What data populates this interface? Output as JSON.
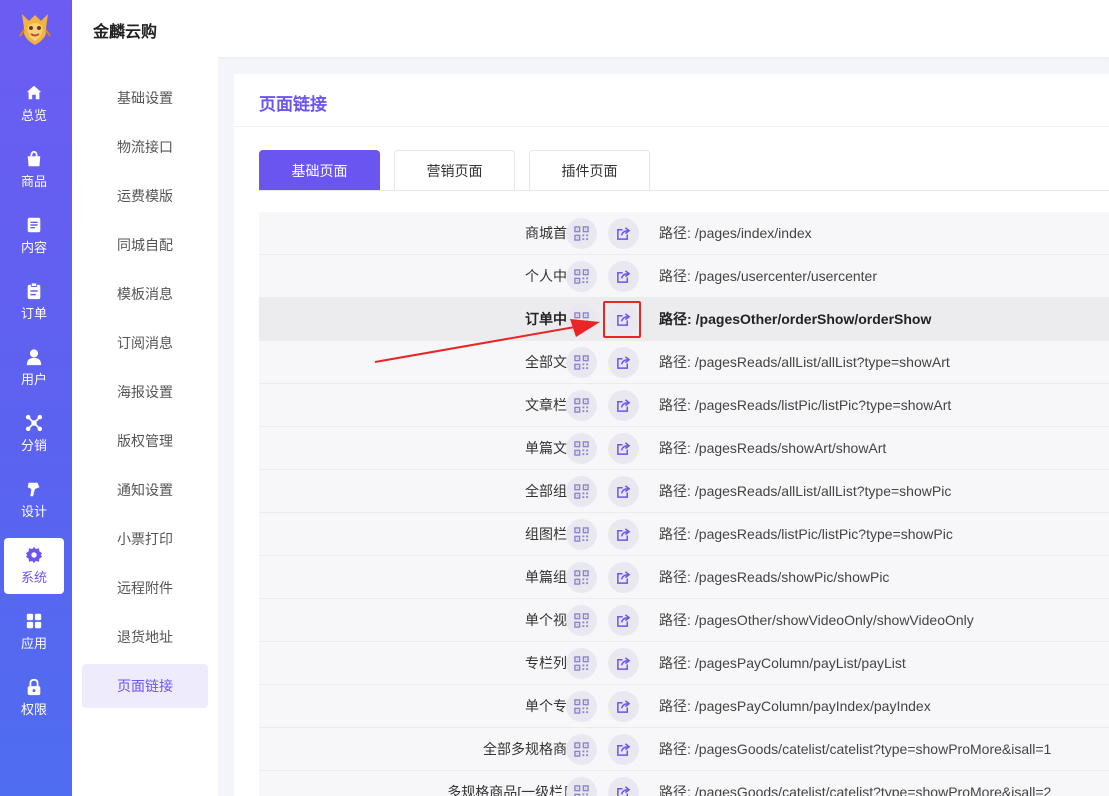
{
  "app": {
    "title": "金麟云购"
  },
  "nav": [
    {
      "label": "总览",
      "icon": "home-icon"
    },
    {
      "label": "商品",
      "icon": "shopping-bag-icon"
    },
    {
      "label": "内容",
      "icon": "document-icon"
    },
    {
      "label": "订单",
      "icon": "clipboard-icon"
    },
    {
      "label": "用户",
      "icon": "user-icon"
    },
    {
      "label": "分销",
      "icon": "network-icon"
    },
    {
      "label": "设计",
      "icon": "brush-icon"
    },
    {
      "label": "系统",
      "icon": "gear-icon",
      "active": true
    },
    {
      "label": "应用",
      "icon": "grid-icon"
    },
    {
      "label": "权限",
      "icon": "lock-icon"
    }
  ],
  "submenu": [
    "基础设置",
    "物流接口",
    "运费模版",
    "同城自配",
    "模板消息",
    "订阅消息",
    "海报设置",
    "版权管理",
    "通知设置",
    "小票打印",
    "远程附件",
    "退货地址",
    "页面链接"
  ],
  "page": {
    "title": "页面链接",
    "tabs": [
      "基础页面",
      "营销页面",
      "插件页面"
    ],
    "path_label": "路径:",
    "rows": [
      {
        "name": "商城首页",
        "path": "/pages/index/index"
      },
      {
        "name": "个人中心",
        "path": "/pages/usercenter/usercenter"
      },
      {
        "name": "订单中心",
        "path": "/pagesOther/orderShow/orderShow"
      },
      {
        "name": "全部文章",
        "path": "/pagesReads/allList/allList?type=showArt"
      },
      {
        "name": "文章栏目",
        "path": "/pagesReads/listPic/listPic?type=showArt"
      },
      {
        "name": "单篇文章",
        "path": "/pagesReads/showArt/showArt"
      },
      {
        "name": "全部组图",
        "path": "/pagesReads/allList/allList?type=showPic"
      },
      {
        "name": "组图栏目",
        "path": "/pagesReads/listPic/listPic?type=showPic"
      },
      {
        "name": "单篇组图",
        "path": "/pagesReads/showPic/showPic"
      },
      {
        "name": "单个视频",
        "path": "/pagesOther/showVideoOnly/showVideoOnly"
      },
      {
        "name": "专栏列表",
        "path": "/pagesPayColumn/payList/payList"
      },
      {
        "name": "单个专栏",
        "path": "/pagesPayColumn/payIndex/payIndex"
      },
      {
        "name": "全部多规格商品",
        "path": "/pagesGoods/catelist/catelist?type=showProMore&isall=1"
      },
      {
        "name": "多规格商品[一级栏目]",
        "path": "/pagesGoods/catelist/catelist?type=showProMore&isall=2"
      }
    ]
  },
  "colors": {
    "primary": "#6a55f0",
    "annotation": "#e82626"
  }
}
